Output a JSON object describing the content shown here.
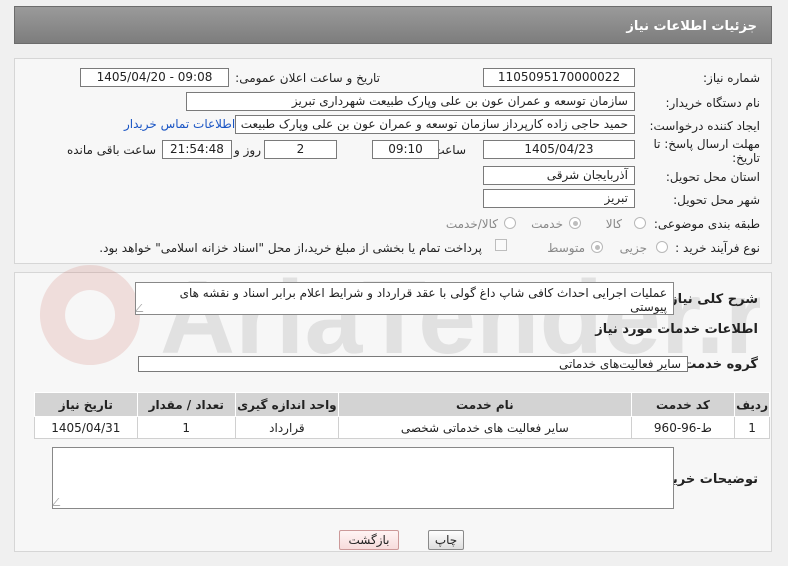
{
  "header": {
    "title": "جزئیات اطلاعات نیاز"
  },
  "fields": {
    "need_number_label": "شماره نیاز:",
    "need_number": "1105095170000022",
    "announce_label": "تاریخ و ساعت اعلان عمومی:",
    "announce_value": "1405/04/20 - 09:08",
    "buyer_org_label": "نام دستگاه خریدار:",
    "buyer_org": "سازمان توسعه و عمران عون بن علی وپارک طبیعت شهرداری تبریز",
    "creator_label": "ایجاد کننده درخواست:",
    "creator": "حمید حاجی زاده کارپرداز سازمان توسعه و عمران عون بن علی وپارک طبیعت شهرداری تبریز",
    "contact_link": "اطلاعات تماس خریدار",
    "deadline_label_1": "مهلت ارسال پاسخ: تا",
    "deadline_label_2": "تاریخ:",
    "deadline_date": "1405/04/23",
    "time_label": "ساعت",
    "deadline_time": "09:10",
    "days_value": "2",
    "days_label": "روز و",
    "remaining_time": "21:54:48",
    "remaining_label": "ساعت باقی مانده",
    "province_label": "استان محل تحویل:",
    "province": "آذربایجان شرقی",
    "city_label": "شهر محل تحویل:",
    "city": "تبریز",
    "category_label": "طبقه بندی موضوعی:",
    "category_options": [
      "کالا",
      "خدمت",
      "کالا/خدمت"
    ],
    "category_selected": "خدمت",
    "process_label": "نوع فرآیند خرید :",
    "process_options": [
      "جزیی",
      "متوسط"
    ],
    "process_selected": "متوسط",
    "payment_note": "پرداخت تمام یا بخشی از مبلغ خرید،از محل \"اسناد خزانه اسلامی\" خواهد بود."
  },
  "summary": {
    "label": "شرح کلی نیاز:",
    "text": "عملیات اجرایی احداث کافی شاپ داغ گولی با عقد قرارداد و شرایط اعلام برابر اسناد و نقشه های پیوستی"
  },
  "services": {
    "section_title": "اطلاعات خدمات مورد نیاز",
    "group_label": "گروه خدمت:",
    "group_value": "سایر فعالیت‌های خدماتی",
    "columns": [
      "ردیف",
      "کد خدمت",
      "نام خدمت",
      "واحد اندازه گیری",
      "تعداد / مقدار",
      "تاریخ نیاز"
    ],
    "rows": [
      [
        "1",
        "ط-96-960",
        "سایر فعالیت های خدماتی شخصی",
        "قرارداد",
        "1",
        "1405/04/31"
      ]
    ]
  },
  "buyer_notes": {
    "label": "توضیحات خریدار:",
    "value": ""
  },
  "buttons": {
    "print": "چاپ",
    "back": "بازگشت"
  },
  "watermark_text": "AriaTender.net",
  "colors": {
    "header": "#8a8a8a",
    "link": "#1a55c4",
    "table_header": "#d3d3d3"
  }
}
